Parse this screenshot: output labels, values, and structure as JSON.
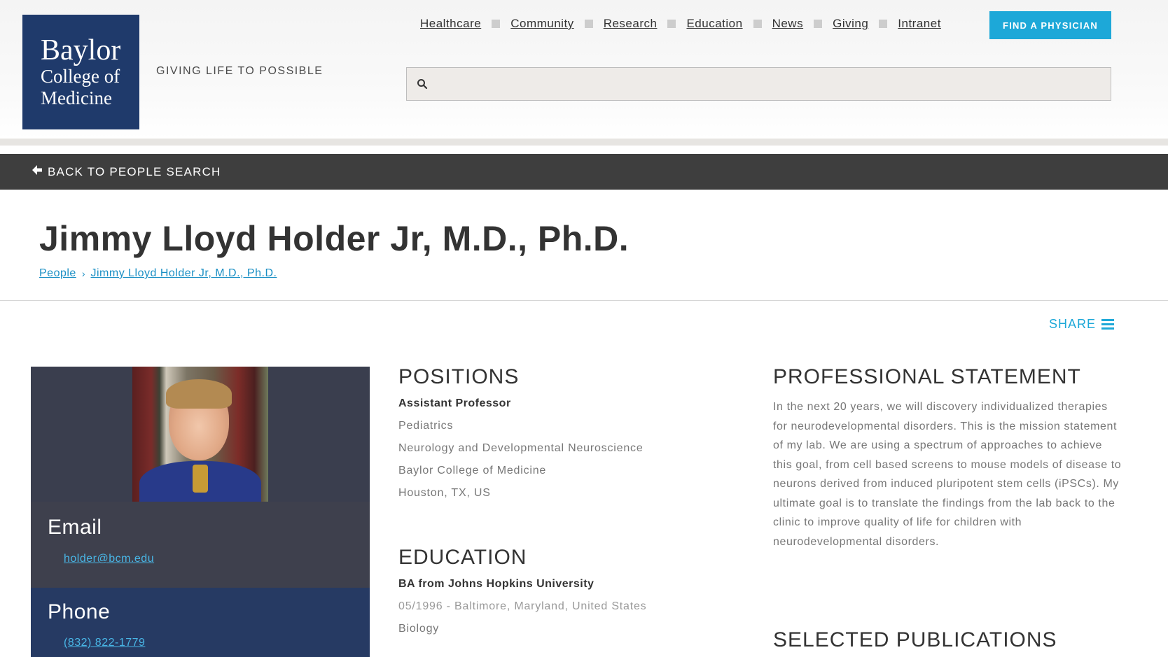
{
  "header": {
    "logo": {
      "line1": "Baylor",
      "line2": "College of",
      "line3": "Medicine"
    },
    "tagline": "GIVING LIFE TO POSSIBLE",
    "nav": [
      "Healthcare",
      "Community",
      "Research",
      "Education",
      "News",
      "Giving",
      "Intranet"
    ],
    "find_button": "FIND A PHYSICIAN",
    "search_placeholder": ""
  },
  "backbar": {
    "label": "BACK TO PEOPLE SEARCH"
  },
  "profile": {
    "name": "Jimmy Lloyd Holder Jr, M.D., Ph.D.",
    "breadcrumb": [
      "People",
      "Jimmy Lloyd Holder Jr, M.D., Ph.D."
    ],
    "share_label": "SHARE",
    "email_label": "Email",
    "email": "holder@bcm.edu",
    "phone_label": "Phone",
    "phone": "(832) 822-1779"
  },
  "positions": {
    "heading": "POSITIONS",
    "title": "Assistant Professor",
    "lines": [
      "Pediatrics",
      "Neurology and Developmental Neuroscience",
      "Baylor College of Medicine",
      "Houston, TX, US"
    ]
  },
  "education": {
    "heading": "EDUCATION",
    "degree": "BA from Johns Hopkins University",
    "date_place": "05/1996 - Baltimore, Maryland, United States",
    "field": "Biology"
  },
  "statement": {
    "heading": "PROFESSIONAL STATEMENT",
    "text": "In the next 20 years, we will discovery individualized therapies for neurodevelopmental disorders. This is the mission statement of my lab. We are using a spectrum of approaches to achieve this goal, from cell based screens to mouse models of disease to neurons derived from induced pluripotent stem cells (iPSCs). My ultimate goal is to translate the findings from the lab back to the clinic to improve quality of life for children with neurodevelopmental disorders."
  },
  "publications": {
    "heading": "SELECTED PUBLICATIONS"
  },
  "colors": {
    "accent": "#1da8d8",
    "navy": "#1f3a6b",
    "backbar": "#3e3e3e",
    "card_dark": "#3e404d",
    "card_blue": "#263a63"
  }
}
